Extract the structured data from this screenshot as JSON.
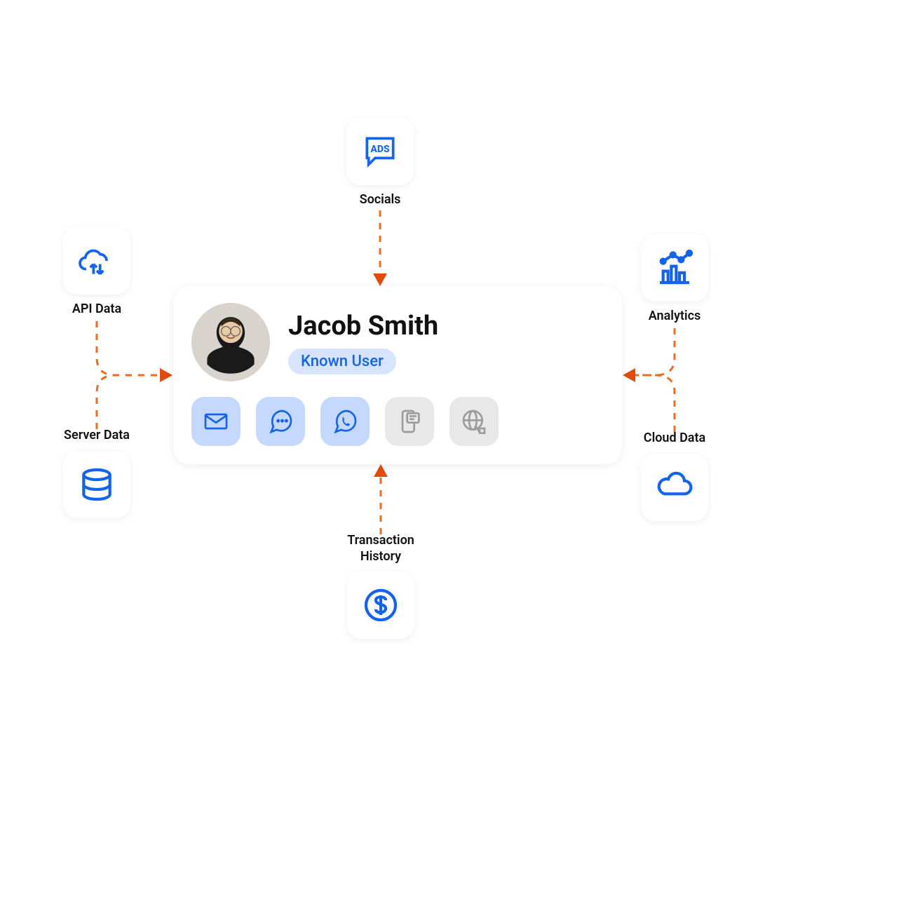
{
  "user": {
    "name": "Jacob Smith",
    "badge": "Known User"
  },
  "channels": {
    "email": "Email",
    "chat": "Chat",
    "whatsapp": "WhatsApp",
    "sms": "SMS",
    "web": "Web"
  },
  "sources": {
    "socials": "Socials",
    "api_data": "API Data",
    "server_data": "Server Data",
    "analytics": "Analytics",
    "cloud_data": "Cloud Data",
    "transaction_history": "Transaction\nHistory"
  },
  "colors": {
    "primary_blue": "#1363eb",
    "accent_orange": "#ed6b1f",
    "badge_bg": "#d7e4ff",
    "active_tile": "#c5d8ff",
    "inactive_tile": "#e8e8e8"
  }
}
